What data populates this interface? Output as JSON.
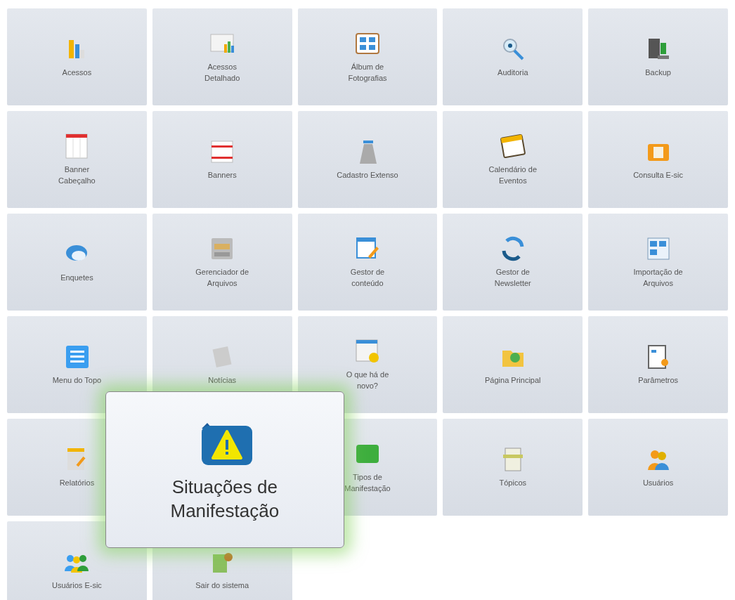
{
  "tiles": [
    {
      "label": "Acessos"
    },
    {
      "label": "Acessos\nDetalhado"
    },
    {
      "label": "Álbum de\nFotografias"
    },
    {
      "label": "Auditoria"
    },
    {
      "label": "Backup"
    },
    {
      "label": "Banner\nCabeçalho"
    },
    {
      "label": "Banners"
    },
    {
      "label": "Cadastro Extenso"
    },
    {
      "label": "Calendário de\nEventos"
    },
    {
      "label": "Consulta E-sic"
    },
    {
      "label": "Enquetes"
    },
    {
      "label": "Gerenciador de\nArquivos"
    },
    {
      "label": "Gestor de\nconteúdo"
    },
    {
      "label": "Gestor de\nNewsletter"
    },
    {
      "label": "Importação de\nArquivos"
    },
    {
      "label": "Menu do Topo"
    },
    {
      "label": "Notícias"
    },
    {
      "label": "O que há de\nnovo?"
    },
    {
      "label": "Página Principal"
    },
    {
      "label": "Parâmetros"
    },
    {
      "label": "Relatórios"
    },
    {
      "kind": "popup",
      "label": "Situações de\nManifestação"
    },
    {
      "label": "Tipos de\nManifestação"
    },
    {
      "label": "Tópicos"
    },
    {
      "label": "Usuários"
    },
    {
      "label": "Usuários E-sic"
    },
    {
      "label": "Sair do sistema"
    }
  ]
}
